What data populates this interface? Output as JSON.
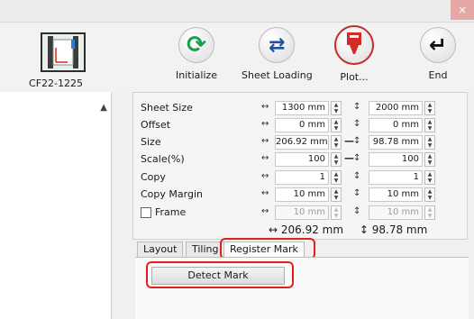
{
  "titlebar": {
    "close_glyph": "×"
  },
  "device": {
    "name": "CF22-1225"
  },
  "toolbar": {
    "initialize": "Initialize",
    "sheet_loading": "Sheet Loading",
    "plot": "Plot...",
    "end": "End"
  },
  "params": {
    "sheet_size": {
      "label": "Sheet Size",
      "h_value": "1300 mm",
      "v_value": "2000 mm"
    },
    "offset": {
      "label": "Offset",
      "h_value": "0 mm",
      "v_value": "0 mm"
    },
    "size": {
      "label": "Size",
      "h_value": "206.92 mm",
      "v_value": "98.78 mm"
    },
    "scale": {
      "label": "Scale(%)",
      "h_value": "100",
      "v_value": "100"
    },
    "copy": {
      "label": "Copy",
      "h_value": "1",
      "v_value": "1"
    },
    "copy_margin": {
      "label": "Copy Margin",
      "h_value": "10 mm",
      "v_value": "10 mm"
    },
    "frame": {
      "label": "Frame",
      "checked": false,
      "h_value": "10 mm",
      "v_value": "10 mm"
    }
  },
  "dimensions": {
    "width": "↔ 206.92 mm",
    "height": "↕ 98.78 mm"
  },
  "tabs": [
    "Layout",
    "Tiling",
    "Register Mark"
  ],
  "active_tab": "Register Mark",
  "register_mark": {
    "detect_button": "Detect Mark"
  },
  "colors": {
    "highlight": "#e0201a",
    "plot_accent": "#c62a2a"
  }
}
